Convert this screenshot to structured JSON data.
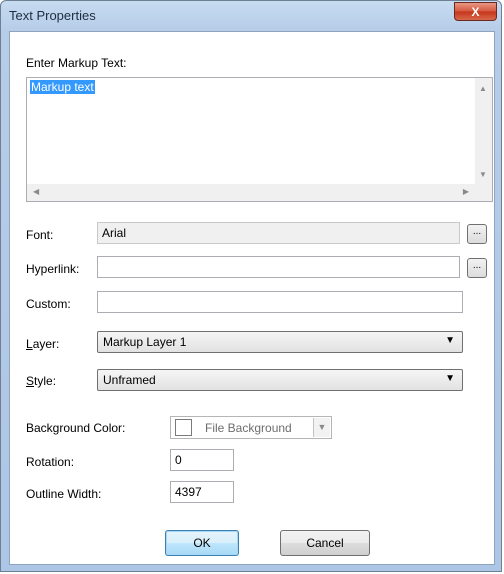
{
  "window": {
    "title": "Text Properties",
    "close_glyph": "X"
  },
  "markup": {
    "label": "Enter Markup Text:",
    "value": "Markup text"
  },
  "font": {
    "label": "Font:",
    "value": "Arial",
    "button": "..."
  },
  "hyperlink": {
    "label": "Hyperlink:",
    "value": "",
    "button": "..."
  },
  "custom": {
    "label": "Custom:",
    "value": ""
  },
  "layer": {
    "label_underlined": "L",
    "label_rest": "ayer:",
    "selected": "Markup Layer 1"
  },
  "style": {
    "label_underlined": "S",
    "label_rest": "tyle:",
    "selected": "Unframed"
  },
  "background_color": {
    "label": "Background Color:",
    "value": "File Background",
    "swatch": "#ffffff"
  },
  "rotation": {
    "label": "Rotation:",
    "value": "0"
  },
  "outline_width": {
    "label": "Outline Width:",
    "value": "4397"
  },
  "buttons": {
    "ok": "OK",
    "cancel": "Cancel"
  }
}
